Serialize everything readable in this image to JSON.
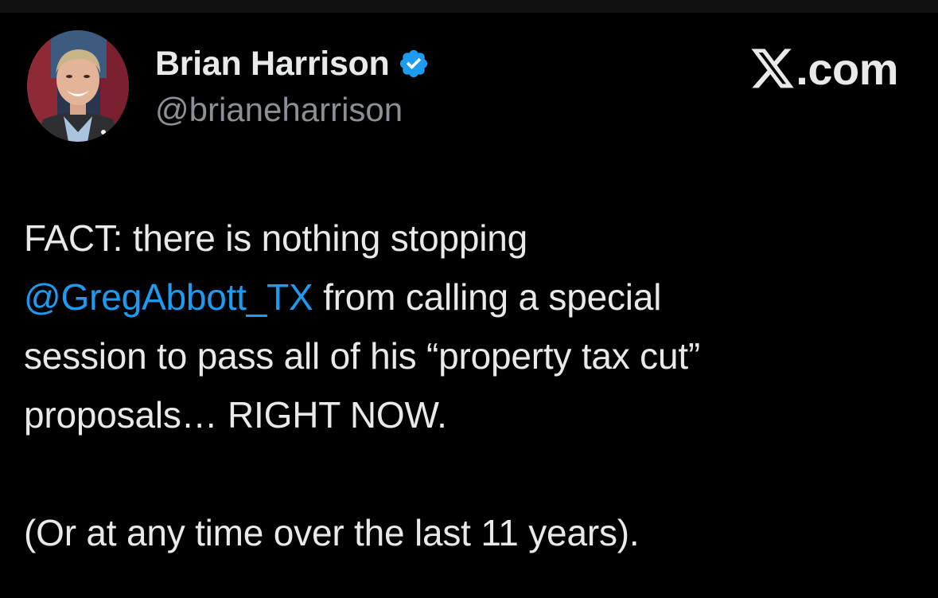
{
  "author": {
    "display_name": "Brian Harrison",
    "handle": "@brianeharrison",
    "verified": true,
    "avatar_icon": "profile-photo"
  },
  "brand": {
    "logo_icon": "x-logo-icon",
    "suffix": ".com"
  },
  "tweet": {
    "line1": "FACT: there is nothing stopping",
    "mention": "@GregAbbott_TX",
    "line2_rest": " from calling a special",
    "line3": "session to pass all of his “property tax cut”",
    "line4": "proposals… RIGHT NOW.",
    "line5": "(Or at any time over the last 11 years)."
  },
  "colors": {
    "background": "#000000",
    "text": "#e7e9ea",
    "secondary_text": "#8b9096",
    "link": "#1d9bf0",
    "verified_badge": "#1d9bf0"
  }
}
